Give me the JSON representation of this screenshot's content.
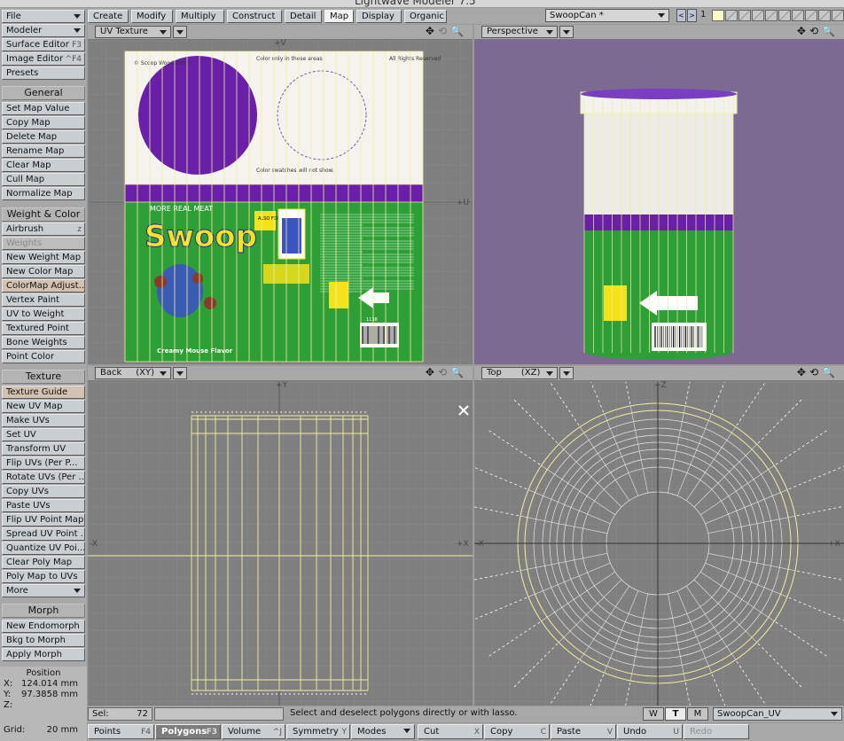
{
  "window": {
    "title": "Lightwave Modeler 7.5"
  },
  "toolbar": {
    "file": "File",
    "modeler": "Modeler",
    "surface_editor": "Surface Editor",
    "surface_editor_key": "F3",
    "image_editor": "Image Editor",
    "image_editor_key": "^F4",
    "presets": "Presets",
    "general_head": "General",
    "general": [
      "Set Map Value",
      "Copy Map",
      "Delete Map",
      "Rename Map",
      "Clear Map",
      "Cull Map",
      "Normalize Map"
    ],
    "weight_head": "Weight & Color",
    "airbrush": "Airbrush",
    "airbrush_key": "z",
    "weights": "Weights",
    "weight_items": [
      "New Weight Map",
      "New Color Map",
      "ColorMap Adjust...",
      "Vertex Paint",
      "UV to Weight",
      "Textured Point",
      "Bone Weights",
      "Point Color"
    ],
    "texture_head": "Texture",
    "texture_guide": "Texture Guide",
    "texture_items": [
      "New UV Map",
      "Make UVs",
      "Set UV",
      "Transform UV",
      "Flip UVs (Per P...",
      "Rotate UVs (Per ...",
      "Copy UVs",
      "Paste UVs",
      "Flip UV Point Map",
      "Spread UV Point ...",
      "Quantize UV Poi...",
      "Clear Poly Map",
      "Poly Map to UVs"
    ],
    "more": "More",
    "morph_head": "Morph",
    "morph_items": [
      "New Endomorph",
      "Bkg to Morph",
      "Apply Morph"
    ]
  },
  "position": {
    "title": "Position",
    "x_label": "X:",
    "x_value": "124.014 mm",
    "y_label": "Y:",
    "y_value": "97.3858 mm",
    "z_label": "Z:",
    "grid_label": "Grid:",
    "grid_value": "20 mm"
  },
  "tabs": [
    "Create",
    "Modify",
    "Multiply",
    "Construct",
    "Detail",
    "Map",
    "Display",
    "Organic"
  ],
  "active_tab": "Map",
  "object": {
    "name": "SwoopCan *",
    "layer_number": "1"
  },
  "viewports": {
    "uv": {
      "mode": "UV Texture",
      "label_v": "+V",
      "label_u": "+U"
    },
    "perspective": {
      "mode": "Perspective"
    },
    "back": {
      "mode": "Back",
      "axis": "(XY)",
      "label_top": "+Y",
      "label_left": "-X",
      "label_right": "+X"
    },
    "top": {
      "mode": "Top",
      "axis": "(XZ)",
      "label_top": "+Z",
      "label_left": "-X",
      "label_right": "+X"
    }
  },
  "label": {
    "company": "© Scoop Wood\n2003",
    "color_note": "Color only in\nthese areas",
    "rights": "All Rights\nReserved",
    "swatches": "Color swatches\nwill not show.",
    "tagline": "MORE REAL MEAT",
    "brand": "Swoop",
    "also": "ALSO\nFOR",
    "upc": "1138",
    "flavor": "Creamy Mouse Flavor"
  },
  "status": {
    "sel_label": "Sel:",
    "sel_value": "72",
    "message": "Select and deselect polygons directly or with lasso.",
    "w": "W",
    "t": "T",
    "m": "M",
    "vmap": "SwoopCan_UV"
  },
  "bottom": {
    "points": "Points",
    "points_key": "F4",
    "polygons": "Polygons",
    "polygons_key": "F3",
    "volume": "Volume",
    "volume_key": "^J",
    "symmetry": "Symmetry",
    "symmetry_key": "Y",
    "modes": "Modes",
    "cut": "Cut",
    "cut_key": "X",
    "copy": "Copy",
    "copy_key": "C",
    "paste": "Paste",
    "paste_key": "V",
    "undo": "Undo",
    "undo_key": "U",
    "redo": "Redo"
  },
  "colors": {
    "purple": "#6a1fa8",
    "green": "#2e9e36",
    "viewport_gray": "#7f7f7f",
    "persp_bg": "#7d6a93",
    "wire": "#f0f0a0"
  }
}
